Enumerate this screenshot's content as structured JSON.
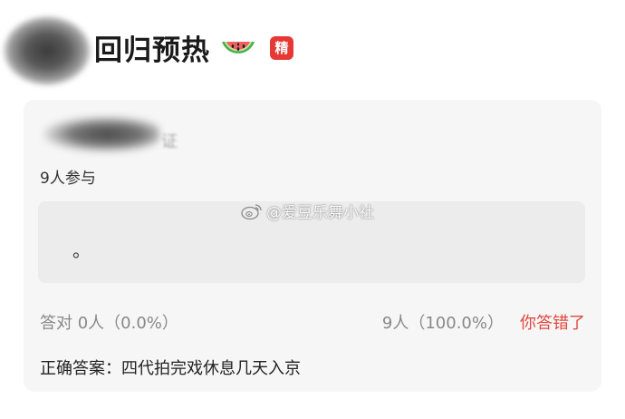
{
  "post": {
    "title": "回归预热",
    "emoji": "watermelon-icon",
    "badge": "精"
  },
  "quiz": {
    "participants": "9人参与",
    "option_text": "。",
    "correct_stat": "答对  0人（0.0%）",
    "wrong_stat": "9人（100.0%）",
    "result": "你答错了",
    "answer": "正确答案：四代拍完戏休息几天入京"
  },
  "watermark": {
    "text": "@爱豆乐舞小社"
  },
  "colors": {
    "badge": "#e53935",
    "wrong": "#e0483d",
    "card": "#f6f6f6"
  }
}
